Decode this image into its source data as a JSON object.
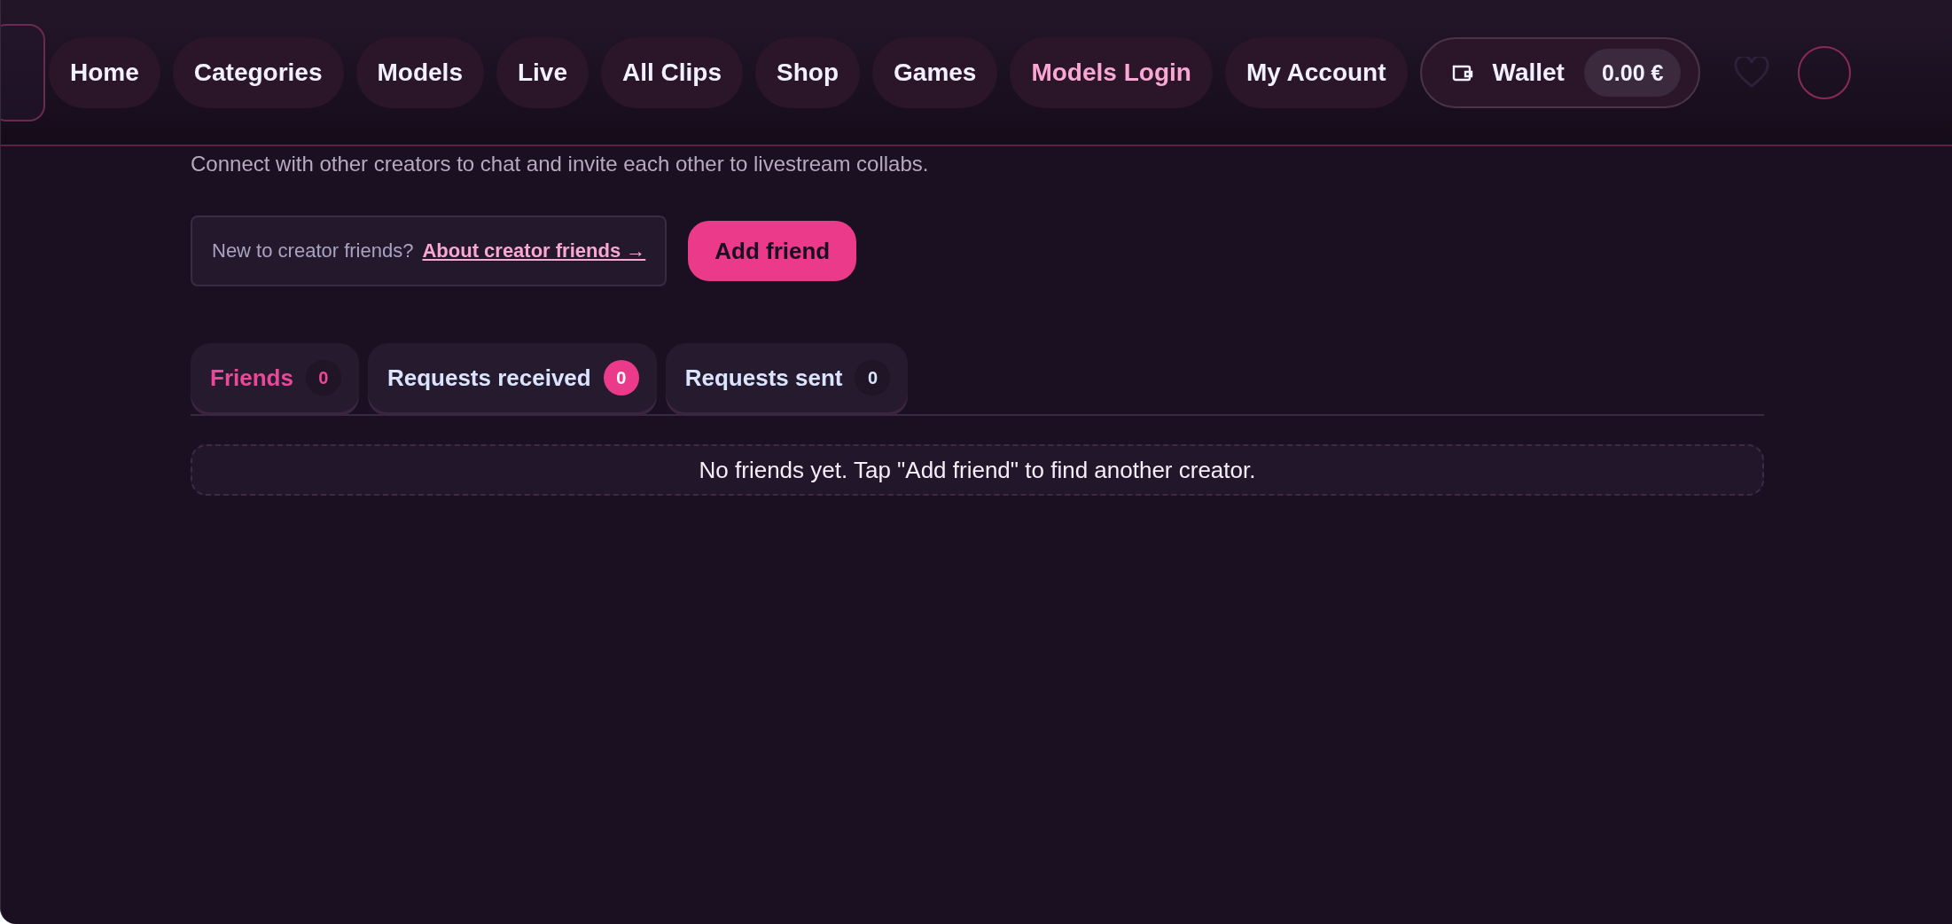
{
  "nav": {
    "items": [
      {
        "label": "Home",
        "highlighted": false
      },
      {
        "label": "Categories",
        "highlighted": false
      },
      {
        "label": "Models",
        "highlighted": false
      },
      {
        "label": "Live",
        "highlighted": false
      },
      {
        "label": "All Clips",
        "highlighted": false
      },
      {
        "label": "Shop",
        "highlighted": false
      },
      {
        "label": "Games",
        "highlighted": false
      },
      {
        "label": "Models Login",
        "highlighted": true
      },
      {
        "label": "My Account",
        "highlighted": false
      }
    ],
    "wallet": {
      "label": "Wallet",
      "balance": "0.00 €"
    }
  },
  "subtitle": "Connect with other creators to chat and invite each other to livestream collabs.",
  "info": {
    "text": "New to creator friends?",
    "link": "About creator friends →"
  },
  "add_button": "Add friend",
  "tabs": [
    {
      "label": "Friends",
      "count": "0",
      "selected": true,
      "badge_highlighted": false
    },
    {
      "label": "Requests received",
      "count": "0",
      "selected": false,
      "badge_highlighted": true
    },
    {
      "label": "Requests sent",
      "count": "0",
      "selected": false,
      "badge_highlighted": false
    }
  ],
  "empty_message": "No friends yet. Tap \"Add friend\" to find another creator."
}
